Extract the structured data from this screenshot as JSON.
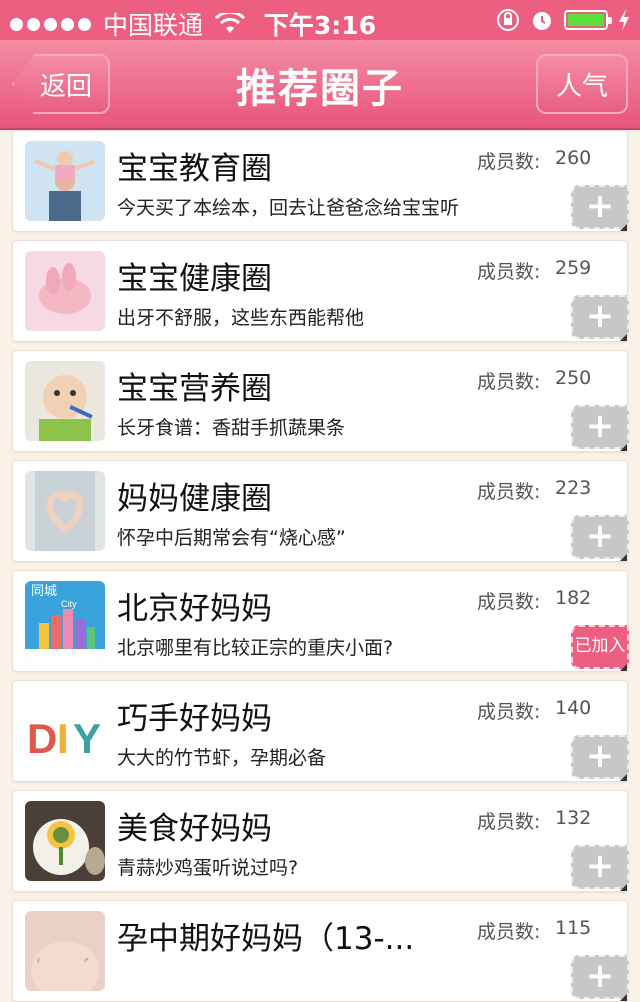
{
  "status_bar": {
    "carrier": "中国联通",
    "time": "下午3:16"
  },
  "nav": {
    "title": "推荐圈子",
    "back_label": "返回",
    "popular_label": "人气"
  },
  "colors": {
    "accent": "#ed5f80",
    "join_gray": "#c7c7c7",
    "background": "#faf1e7"
  },
  "members_label": "成员数:",
  "circles": [
    {
      "name": "宝宝教育圈",
      "members": "260",
      "desc": "今天买了本绘本，回去让爸爸念给宝宝听",
      "joined": false,
      "join_label": "+"
    },
    {
      "name": "宝宝健康圈",
      "members": "259",
      "desc": "出牙不舒服，这些东西能帮他",
      "joined": false,
      "join_label": "+"
    },
    {
      "name": "宝宝营养圈",
      "members": "250",
      "desc": "长牙食谱：香甜手抓蔬果条",
      "joined": false,
      "join_label": "+"
    },
    {
      "name": "妈妈健康圈",
      "members": "223",
      "desc": "怀孕中后期常会有“烧心感”",
      "joined": false,
      "join_label": "+"
    },
    {
      "name": "北京好妈妈",
      "members": "182",
      "desc": "北京哪里有比较正宗的重庆小面?",
      "joined": true,
      "join_label": "已加入",
      "thumb_text": "同城",
      "thumb_text2": "City"
    },
    {
      "name": "巧手好妈妈",
      "members": "140",
      "desc": "大大的竹节虾，孕期必备",
      "joined": false,
      "join_label": "+",
      "thumb_text": "DIY"
    },
    {
      "name": "美食好妈妈",
      "members": "132",
      "desc": "青蒜炒鸡蛋听说过吗?",
      "joined": false,
      "join_label": "+"
    },
    {
      "name": "孕中期好妈妈（13-...",
      "members": "115",
      "desc": "",
      "joined": false,
      "join_label": "+"
    }
  ]
}
